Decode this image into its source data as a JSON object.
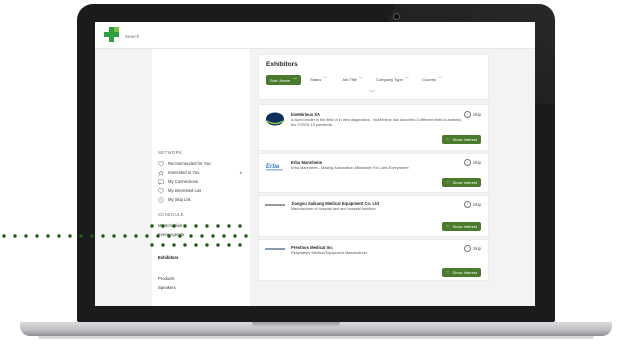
{
  "topbar": {
    "search_placeholder": "Search"
  },
  "sidebar": {
    "network_label": "NETWORK",
    "network_items": [
      {
        "label": "Recommended for You",
        "icon": "heart-icon"
      },
      {
        "label": "Interested In You",
        "icon": "star-icon",
        "count": "6"
      },
      {
        "label": "My Connections",
        "icon": "chat-icon"
      },
      {
        "label": "My Interested List",
        "icon": "heart-icon"
      },
      {
        "label": "My Skip List",
        "icon": "skip-icon"
      }
    ],
    "schedule_label": "SCHEDULE",
    "schedule_items": [
      {
        "label": "My Schedule"
      },
      {
        "label": "Event Agenda"
      },
      {
        "label": "Exhibitors"
      },
      {
        "label": "Products"
      },
      {
        "label": "Speakers"
      }
    ]
  },
  "main": {
    "title": "Exhibitors",
    "sort_label": "Sort: Name",
    "filters": [
      "Status",
      "Job Title",
      "Company Type",
      "Country"
    ]
  },
  "exhibitors": [
    {
      "name": "bioMérieux SA",
      "description": "A world leader in the field of in vitro diagnostics , bioMérieux has launched 3 different tests to address the COVID-19 pandemic.",
      "skip_label": "Skip",
      "button_label": "Show Interest"
    },
    {
      "name": "Erba Mannheim",
      "description": "Erba Mannheim - Making Automation Affordable For Labs Everywhere",
      "skip_label": "Skip",
      "button_label": "Show Interest"
    },
    {
      "name": "Jiangsu Saikang Medical Equipment Co. Ltd",
      "description": "Manufacturer of hospital bed and hospital furniture",
      "skip_label": "Skip",
      "button_label": "Show Interest"
    },
    {
      "name": "Prestnos Medical Inc",
      "description": "Respiratory Medical Equipment Manufacturer",
      "skip_label": "Skip",
      "button_label": "Show Interest"
    }
  ],
  "colors": {
    "accent_green": "#4a7a2c",
    "logo_green": "#2e9e3e",
    "dot_green": "#1f5a14"
  }
}
